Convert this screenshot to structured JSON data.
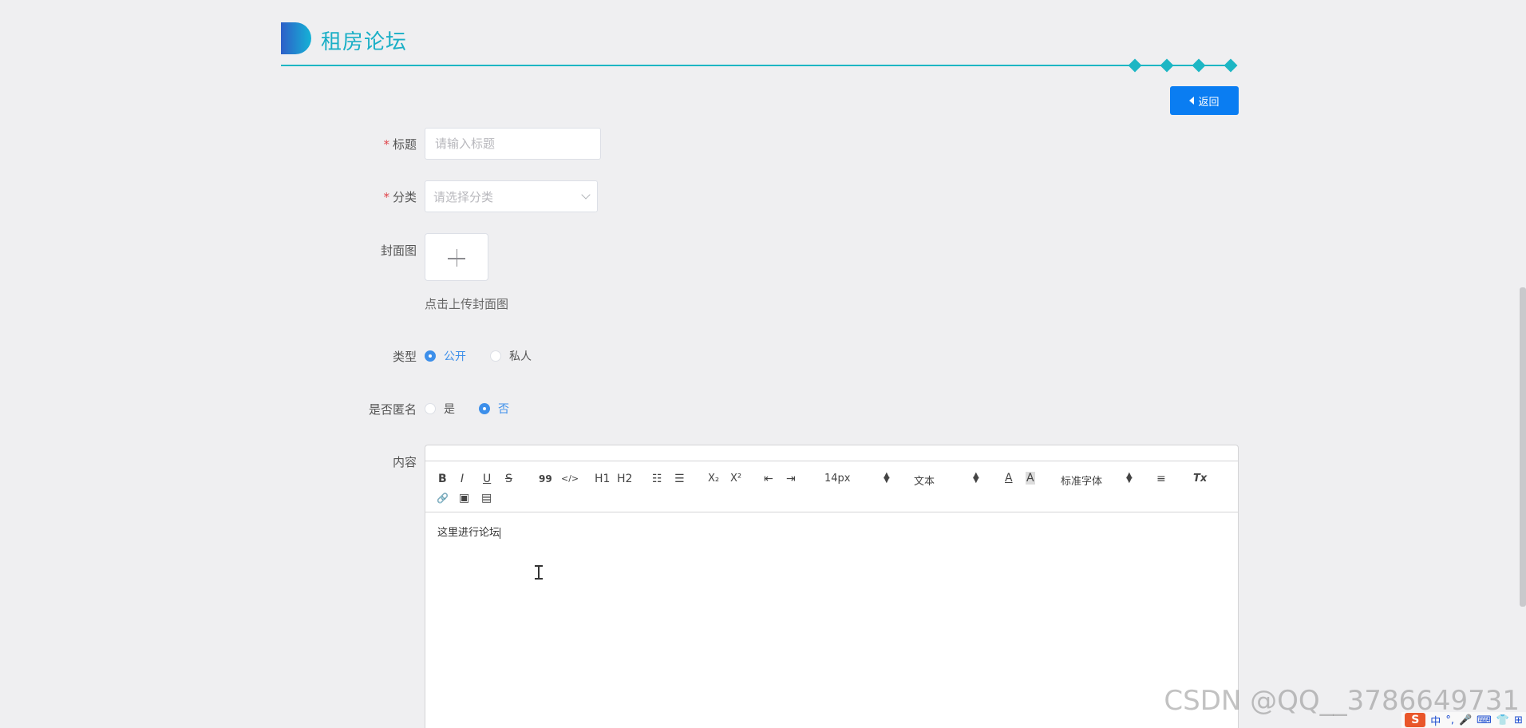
{
  "header": {
    "title": "租房论坛"
  },
  "back_button": {
    "label": "返回"
  },
  "form": {
    "title_field": {
      "label": "标题",
      "placeholder": "请输入标题",
      "value": ""
    },
    "category_field": {
      "label": "分类",
      "placeholder": "请选择分类"
    },
    "cover_field": {
      "label": "封面图",
      "hint": "点击上传封面图"
    },
    "type_field": {
      "label": "类型",
      "options": [
        "公开",
        "私人"
      ],
      "selected": "公开"
    },
    "anonymous_field": {
      "label": "是否匿名",
      "options": [
        "是",
        "否"
      ],
      "selected": "否"
    },
    "content_field": {
      "label": "内容",
      "text": "这里进行论坛"
    }
  },
  "editor_toolbar": {
    "bold": "B",
    "italic": "I",
    "underline": "U",
    "strike": "S",
    "blockquote": "99",
    "code": "</>",
    "h1": "H1",
    "h2": "H2",
    "ordered_list": "☷",
    "bullet_list": "☰",
    "subscript": "X₂",
    "superscript": "X²",
    "outdent": "⇤",
    "indent": "⇥",
    "size": "14px",
    "header": "文本",
    "font": "标准字体",
    "align": "≡",
    "clean": "Tx",
    "link": "🔗",
    "image": "▣",
    "video": "▤"
  },
  "watermark": "CSDN @QQ__3786649731",
  "ime": {
    "logo": "S",
    "lang": "中"
  },
  "colors": {
    "accent": "#1db6c4",
    "primary": "#0a7df2",
    "radio_checked": "#3d8fea",
    "required": "#e0454b",
    "background": "#efeff1"
  }
}
